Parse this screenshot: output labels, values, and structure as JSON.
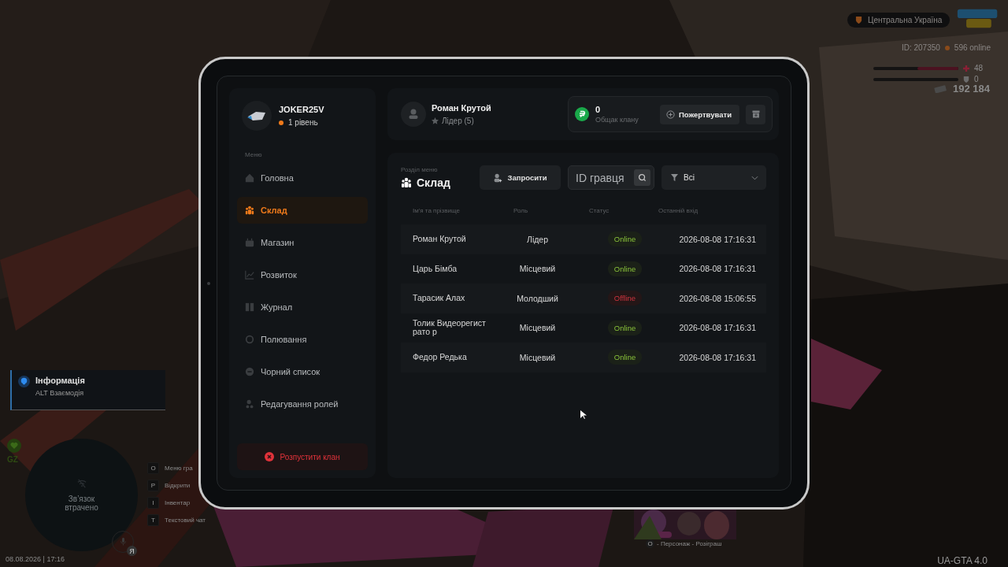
{
  "hud": {
    "region": "Центральна Україна",
    "player_id": "ID: 207350",
    "online": "596 online",
    "health": {
      "level": 0.48,
      "reading": "48"
    },
    "armor": {
      "level": 0,
      "reading": "0"
    },
    "money": "192 184"
  },
  "notification": {
    "title": "Інформація",
    "text": "ALT Взаємодія"
  },
  "zone": "GZ",
  "minimap": {
    "message": "Зв’язок втрачено"
  },
  "key_hints": [
    {
      "key": "O",
      "label": "Меню гра"
    },
    {
      "key": "P",
      "label": "Відкрити"
    },
    {
      "key": "I",
      "label": "Інвентар"
    },
    {
      "key": "T",
      "label": "Текстовий чат"
    }
  ],
  "mic": {
    "badge": "Я"
  },
  "datetime": "08.08.2026 | 17:16",
  "promo": {
    "key": "O",
    "caption": "- Персонаж - Розіграш"
  },
  "version": "UA-GTA 4.0",
  "tablet": {
    "profile": {
      "name": "JOKER25V",
      "level": "1 рівень"
    },
    "menu_title": "Меню",
    "menu": [
      {
        "label": "Головна",
        "selected": false
      },
      {
        "label": "Склад",
        "selected": true
      },
      {
        "label": "Магазин",
        "selected": false
      },
      {
        "label": "Розвиток",
        "selected": false
      },
      {
        "label": "Журнал",
        "selected": false
      },
      {
        "label": "Полювання",
        "selected": false
      },
      {
        "label": "Чорний список",
        "selected": false
      },
      {
        "label": "Редагування ролей",
        "selected": false
      }
    ],
    "disband": "Розпустити клан",
    "member": {
      "name": "Роман Крутой",
      "rank": "Лідер (5)"
    },
    "treasury": {
      "amount": "0",
      "label": "Общак клану"
    },
    "donate": "Пожертвувати",
    "section": {
      "caption": "Розділ меню",
      "title": "Склад"
    },
    "invite": "Запросити",
    "search": {
      "placeholder": "ID гравця"
    },
    "filter": {
      "value": "Всі"
    },
    "table": {
      "columns": [
        "Ім'я та прізвище",
        "Роль",
        "Статус",
        "Останній вхід"
      ],
      "rows": [
        {
          "name": "Роман Крутой",
          "role": "Лідер",
          "status": "Online",
          "online": true,
          "last": "2026-08-08 17:16:31"
        },
        {
          "name": "Царь Бімба",
          "role": "Місцевий",
          "status": "Online",
          "online": true,
          "last": "2026-08-08 17:16:31"
        },
        {
          "name": "Тарасик Алах",
          "role": "Молодший",
          "status": "Offline",
          "online": false,
          "last": "2026-08-08 15:06:55"
        },
        {
          "name": "Толик Видеорегистрато р",
          "role": "Місцевий",
          "status": "Online",
          "online": true,
          "last": "2026-08-08 17:16:31"
        },
        {
          "name": "Федор Редька",
          "role": "Місцевий",
          "status": "Online",
          "online": true,
          "last": "2026-08-08 17:16:31"
        }
      ]
    }
  }
}
